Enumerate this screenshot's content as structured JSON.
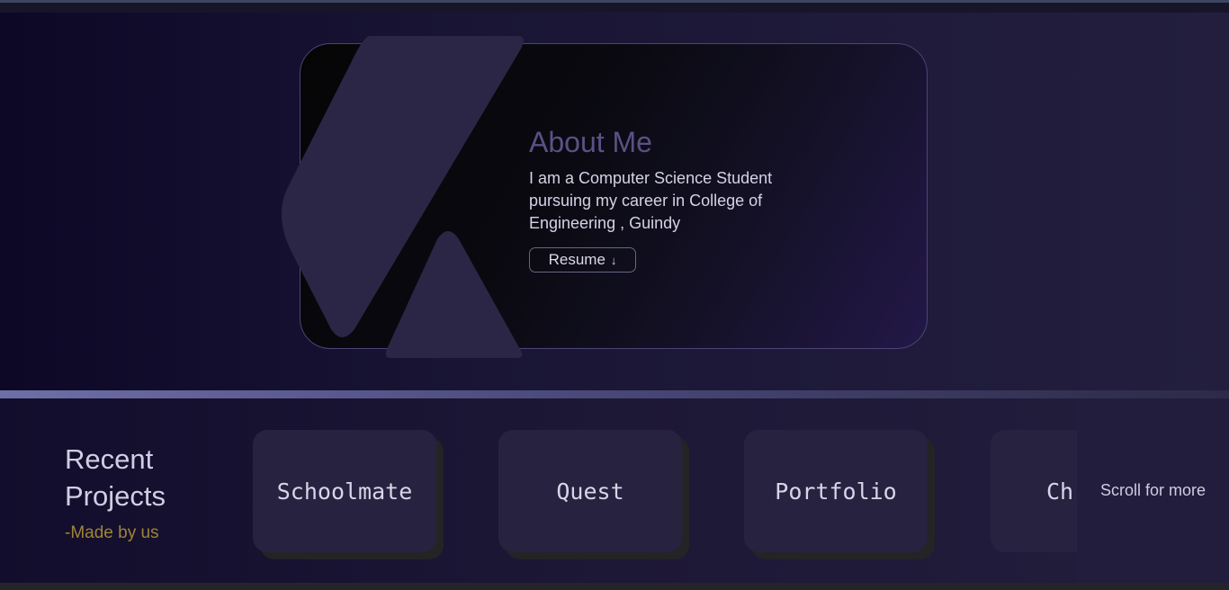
{
  "about": {
    "title": "About Me",
    "description": "I am a Computer Science Student pursuing my career in College of Engineering , Guindy",
    "resume_label": "Resume",
    "resume_icon": "arrow-down-icon"
  },
  "projects": {
    "title": "Recent Projects",
    "subtitle": "-Made by us",
    "items": [
      {
        "label": "Schoolmate"
      },
      {
        "label": "Quest"
      },
      {
        "label": "Portfolio"
      },
      {
        "label": "Ch"
      }
    ],
    "scroll_hint": "Scroll for more"
  },
  "colors": {
    "accent_purple": "#5a5184",
    "card_bg": "#272240",
    "subtitle_gold": "#a08436",
    "logo_fill": "#2b2645"
  }
}
